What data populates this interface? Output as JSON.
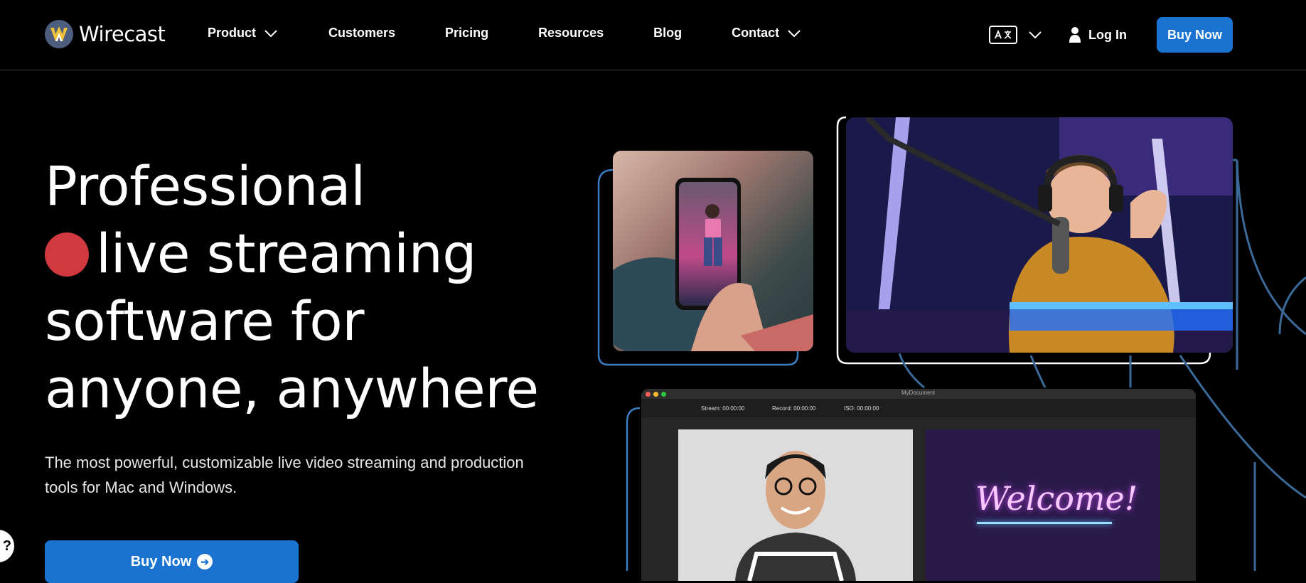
{
  "nav": {
    "brand": "Wirecast",
    "items": [
      {
        "label": "Product",
        "has_dropdown": true
      },
      {
        "label": "Customers",
        "has_dropdown": false
      },
      {
        "label": "Pricing",
        "has_dropdown": false
      },
      {
        "label": "Resources",
        "has_dropdown": false
      },
      {
        "label": "Blog",
        "has_dropdown": false
      },
      {
        "label": "Contact",
        "has_dropdown": true
      }
    ],
    "login_label": "Log In",
    "buy_label": "Buy Now",
    "language_icon": "translate-icon"
  },
  "hero": {
    "line1": "Professional",
    "line2": "live streaming",
    "line3": "software for",
    "line4": "anyone, anywhere",
    "subtitle": "The most powerful, customizable live video streaming and production tools for Mac and Windows.",
    "cta_label": "Buy Now"
  },
  "app_window": {
    "title": "MyDocument",
    "stream_label": "Stream: 00:00:00",
    "record_label": "Record: 00:00:00",
    "iso_label": "ISO: 00:00:00",
    "welcome_text": "Welcome!"
  },
  "colors": {
    "accent": "#1a73d0",
    "live_dot": "#d2383f",
    "background": "#000000",
    "deco_line": "#3b6a99"
  }
}
